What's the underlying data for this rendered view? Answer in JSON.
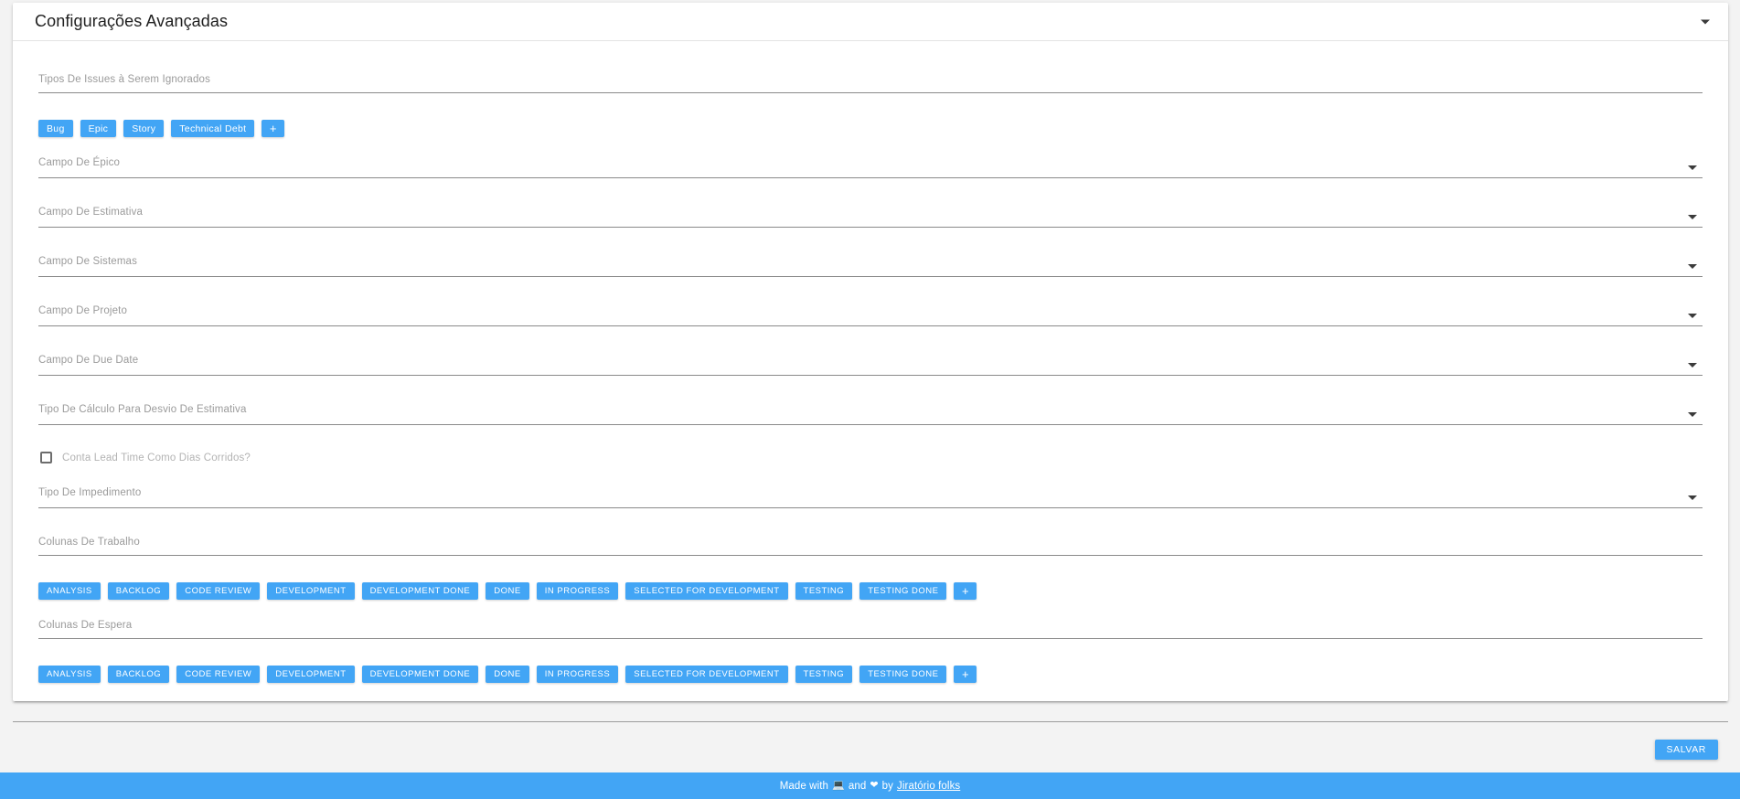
{
  "panel": {
    "title": "Configurações Avançadas",
    "caret_icon": "chevron-down-icon"
  },
  "form": {
    "ignored_issue_types": {
      "label": "Tipos De Issues à Serem Ignorados",
      "chips": [
        "Bug",
        "Epic",
        "Story",
        "Technical Debt"
      ],
      "add_label": "+"
    },
    "selects": [
      {
        "label": "Campo De Épico",
        "value": "",
        "caret_icon": "chevron-down-icon"
      },
      {
        "label": "Campo De Estimativa",
        "value": "",
        "caret_icon": "chevron-down-icon"
      },
      {
        "label": "Campo De Sistemas",
        "value": "",
        "caret_icon": "chevron-down-icon"
      },
      {
        "label": "Campo De Projeto",
        "value": "",
        "caret_icon": "chevron-down-icon"
      },
      {
        "label": "Campo De Due Date",
        "value": "",
        "caret_icon": "chevron-down-icon"
      },
      {
        "label": "Tipo De Cálculo Para Desvio De Estimativa",
        "value": "",
        "caret_icon": "chevron-down-icon"
      }
    ],
    "lead_time_checkbox": {
      "label": "Conta Lead Time Como Dias Corridos?",
      "checked": false
    },
    "impediment_type": {
      "label": "Tipo De Impedimento",
      "value": "",
      "caret_icon": "chevron-down-icon"
    },
    "work_columns": {
      "label": "Colunas De Trabalho",
      "chips": [
        "ANALYSIS",
        "BACKLOG",
        "CODE REVIEW",
        "DEVELOPMENT",
        "DEVELOPMENT DONE",
        "DONE",
        "IN PROGRESS",
        "SELECTED FOR DEVELOPMENT",
        "TESTING",
        "TESTING DONE"
      ],
      "add_label": "+"
    },
    "wait_columns": {
      "label": "Colunas De Espera",
      "chips": [
        "ANALYSIS",
        "BACKLOG",
        "CODE REVIEW",
        "DEVELOPMENT",
        "DEVELOPMENT DONE",
        "DONE",
        "IN PROGRESS",
        "SELECTED FOR DEVELOPMENT",
        "TESTING",
        "TESTING DONE"
      ],
      "add_label": "+"
    }
  },
  "actions": {
    "save_label": "SALVAR"
  },
  "footer": {
    "prefix": "Made with",
    "laptop_icon": "💻",
    "conjunction": "and",
    "heart_icon": "❤",
    "by": "by",
    "link_label": "Jiratório folks"
  },
  "colors": {
    "accent": "#42a5f5",
    "page_background": "#f3f3f3",
    "card_background": "#ffffff",
    "label_text": "#9a9a9a",
    "title_text": "#202020",
    "underline": "#8a8a8a"
  }
}
